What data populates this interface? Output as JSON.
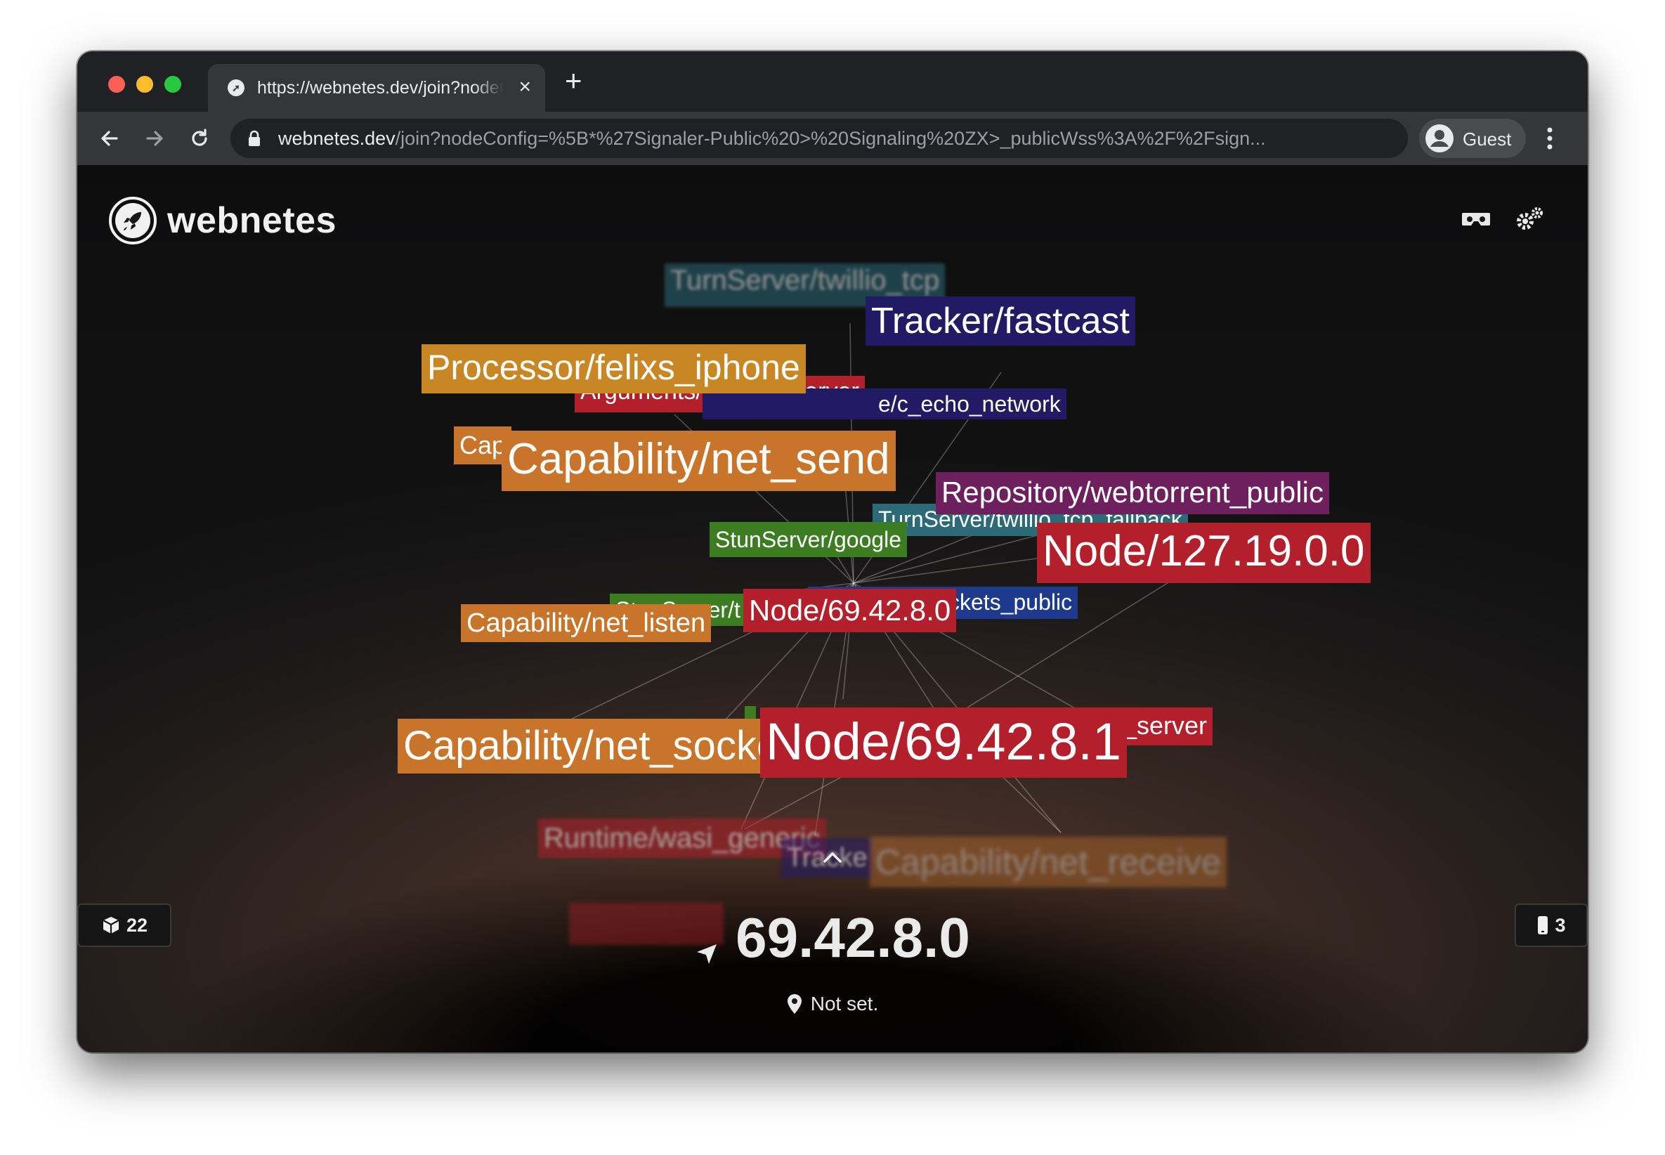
{
  "browser": {
    "tab_title": "https://webnetes.dev/join?nodeConfig=",
    "tab_close": "×",
    "new_tab": "+",
    "url_host": "webnetes.dev",
    "url_path": "/join?nodeConfig=%5B*%27Signaler-Public%20>%20Signaling%20ZX>_publicWss%3A%2F%2Fsign...",
    "profile_label": "Guest"
  },
  "app": {
    "brand": "webnetes",
    "resources_count": "22",
    "nodes_count": "3",
    "node_ip": "69.42.8.0",
    "location": "Not set."
  },
  "graph_labels": [
    "TurnServer/twillio_tcp",
    "Tracker/fastcast",
    "Processor/felixs_iphone",
    "Arguments/c_echo_server",
    "e/c_echo_network",
    "Cap",
    "Capability/net_send",
    "Repository/webtorrent_public",
    "TurnServer/twillio_tcp_fallback",
    "StunServer/google",
    "Node/127.19.0.0",
    "StunServer/t",
    "Node/69.42.8.0",
    "ckets_public",
    "Capability/net_listen",
    "Capability/net_socke",
    "Node/69.42.8.1",
    "_server",
    "Runtime/wasi_generic",
    "Tracke",
    "Capability/net_receive"
  ],
  "colors": {
    "red": "#b31f2b",
    "orange": "#c8742b",
    "teal": "#2c6a78",
    "navy": "#231a66",
    "blue": "#1e3a8f",
    "green": "#3d7d22",
    "purple": "#6e1f5e",
    "gold": "#c98624"
  }
}
